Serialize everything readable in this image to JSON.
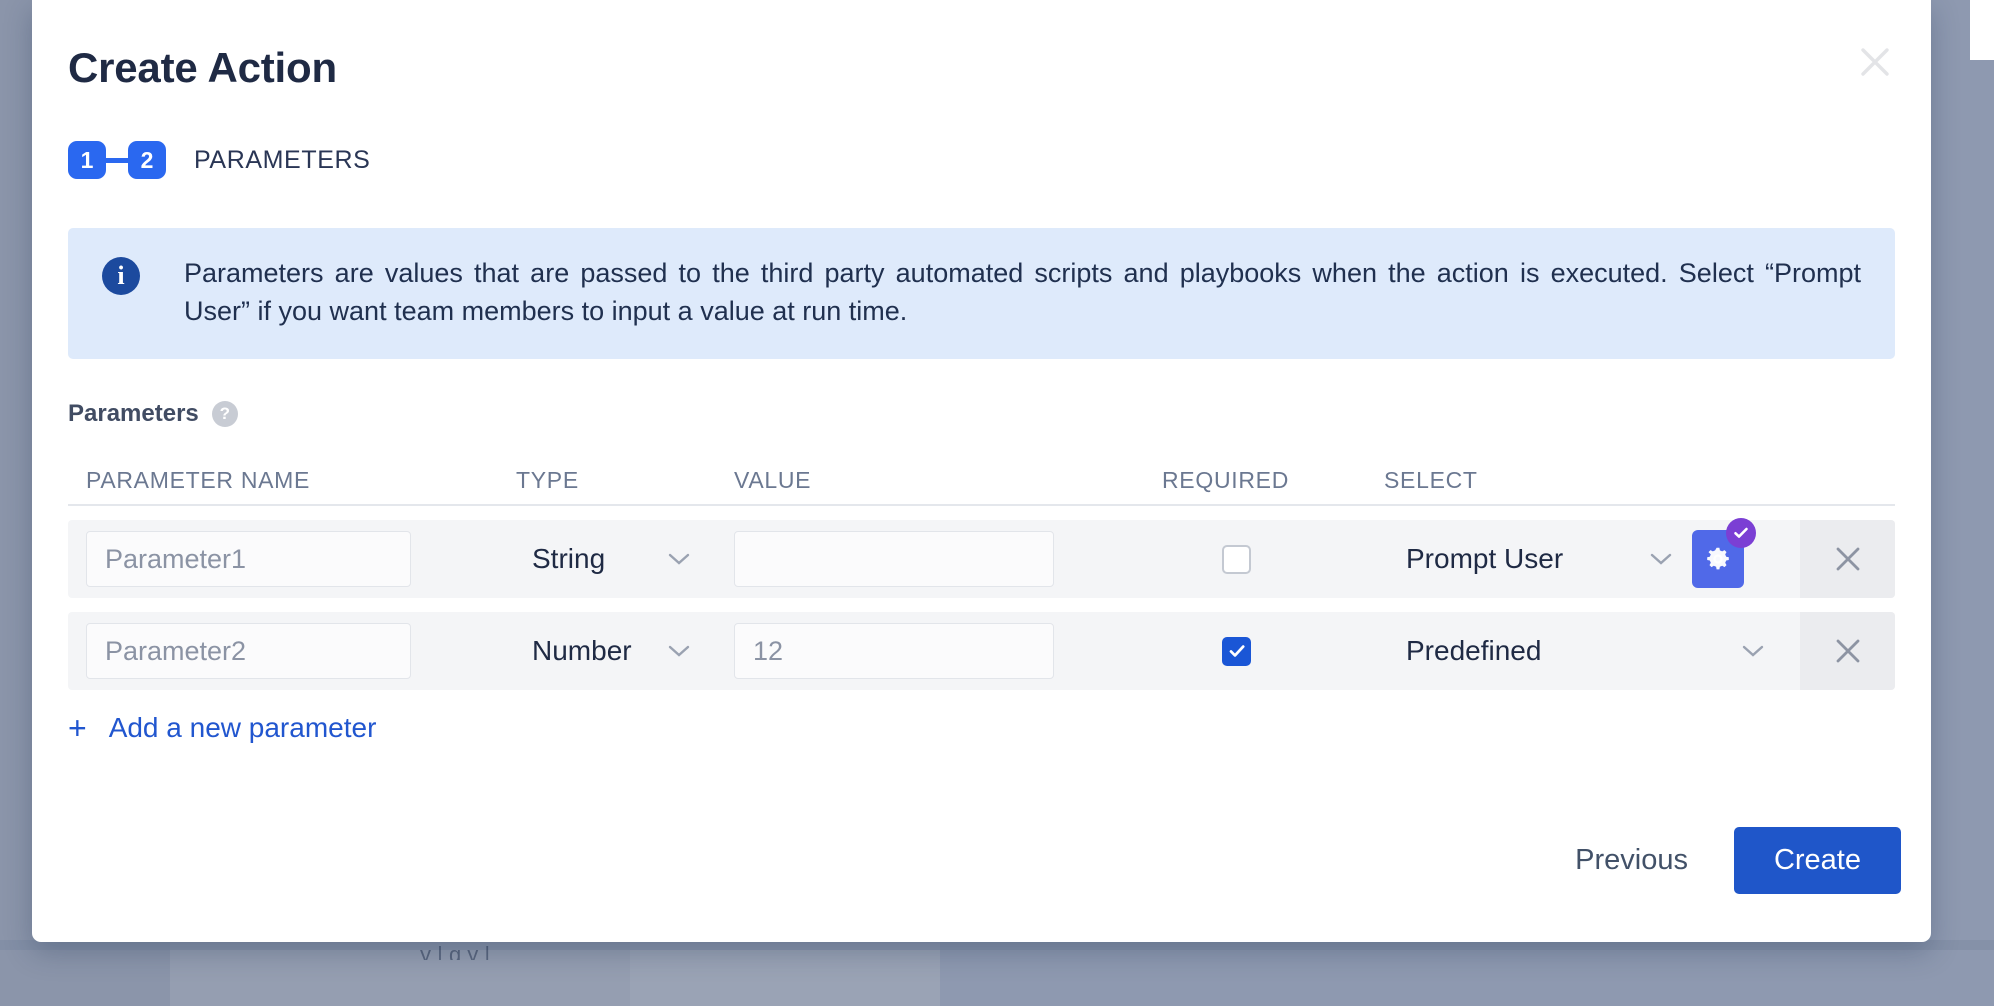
{
  "modal": {
    "title": "Create Action",
    "close_icon": "close-icon",
    "stepper": {
      "steps": [
        {
          "number": "1"
        },
        {
          "number": "2"
        }
      ],
      "label": "PARAMETERS"
    },
    "info_banner": {
      "icon": "info-icon",
      "icon_glyph": "i",
      "text": "Parameters are values that are passed to the third party automated scripts and playbooks when the action is executed. Select “Prompt User” if you want team members to input a value at run time.",
      "background_color": "#deeafb",
      "icon_color": "#1c4a9e"
    },
    "parameters_section": {
      "label": "Parameters",
      "help_icon": "help-icon",
      "help_glyph": "?",
      "columns": [
        "PARAMETER NAME",
        "TYPE",
        "VALUE",
        "REQUIRED",
        "SELECT"
      ],
      "rows": [
        {
          "name_placeholder": "Parameter1",
          "name_value": "",
          "type": "String",
          "value": "",
          "value_placeholder": "",
          "required": false,
          "select": "Prompt User",
          "has_gear": true,
          "gear_icon": "gear-icon",
          "gear_badge_icon": "check-badge-icon",
          "remove_icon": "close-icon"
        },
        {
          "name_placeholder": "Parameter2",
          "name_value": "",
          "type": "Number",
          "value": "12",
          "value_placeholder": "12",
          "required": true,
          "select": "Predefined",
          "has_gear": false,
          "remove_icon": "close-icon"
        }
      ],
      "add_parameter": {
        "plus": "+",
        "label": "Add a new parameter"
      }
    },
    "footer": {
      "previous_label": "Previous",
      "create_label": "Create",
      "primary_color": "#1f56c9"
    }
  },
  "backdrop": {
    "overlay_color": "#8d97ac",
    "ghost_text": "y                                    | g                                    y                 |"
  }
}
